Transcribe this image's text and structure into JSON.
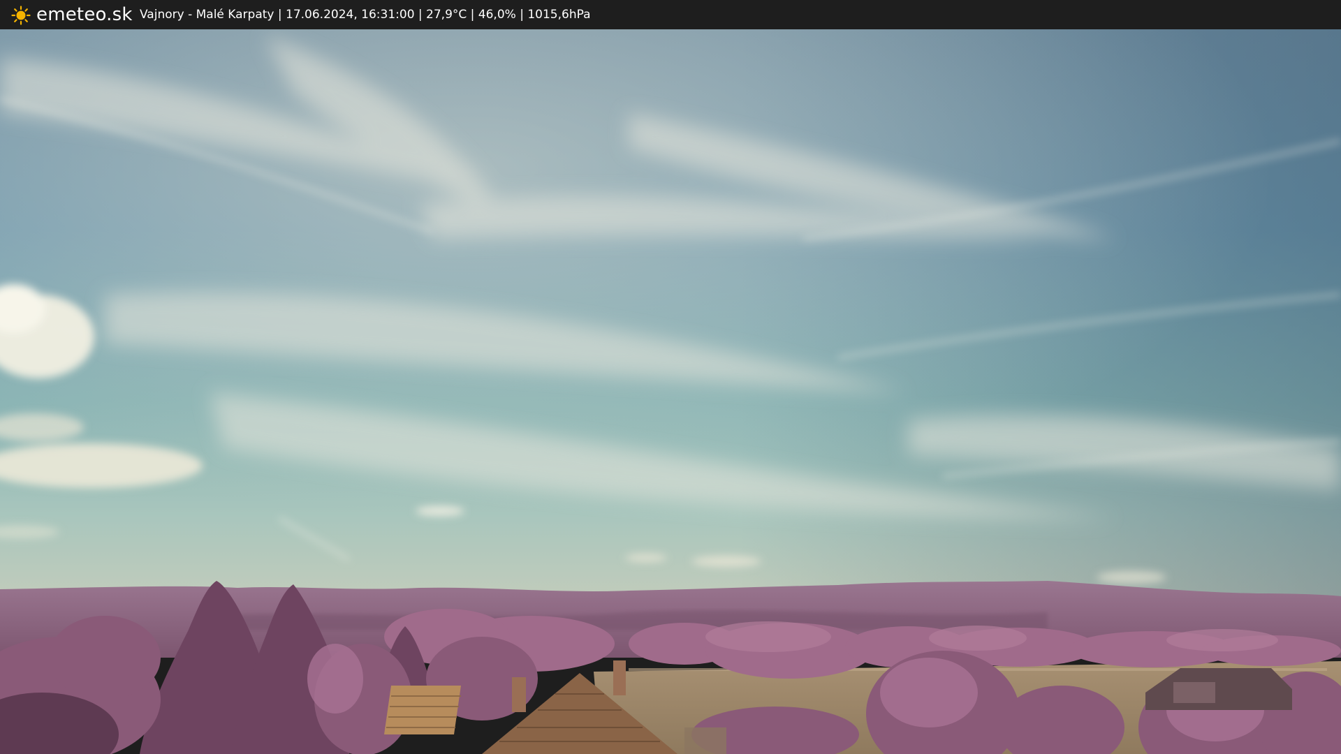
{
  "header": {
    "brand": "emeteo.sk",
    "brand_icon": "sun-icon",
    "info_line": "Vajnory - Malé Karpaty | 17.06.2024, 16:31:00 | 27,9°C | 46,0% | 1015,6hPa"
  },
  "colors": {
    "bar_background": "#1e1e1e",
    "sun": "#f5b400",
    "sky_top": "#5d7f95",
    "sky_horizon": "#7fb3b0",
    "hills": "#8a5a78",
    "foliage": "#9a6687",
    "field": "#a08868"
  }
}
